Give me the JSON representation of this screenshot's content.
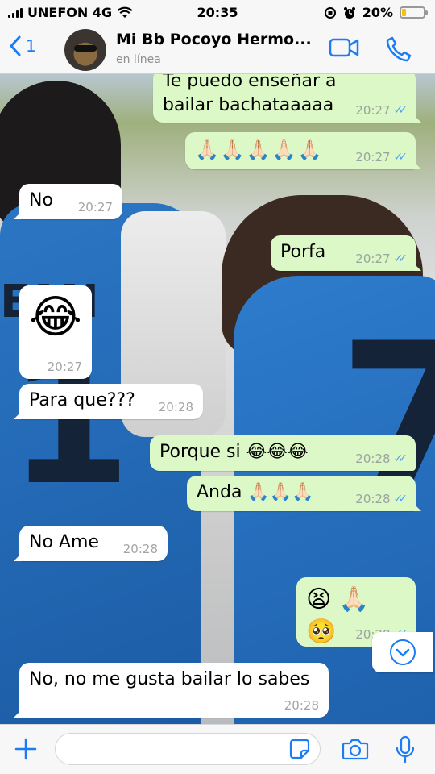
{
  "status": {
    "carrier": "UNEFON 4G",
    "time": "20:35",
    "battery": "20%",
    "battery_level": 0.2
  },
  "header": {
    "back_count": "1",
    "title": "Mi Bb Pocoyo Hermo...",
    "subtitle": "en línea"
  },
  "messages": [
    {
      "text": "Te puedo enseñar a bailar bachataaaaa",
      "time": "20:27",
      "dir": "out"
    },
    {
      "text": "🙏🏻🙏🏻🙏🏻🙏🏻🙏🏻",
      "time": "20:27",
      "dir": "out"
    },
    {
      "text": "No",
      "time": "20:27",
      "dir": "in"
    },
    {
      "text": "Porfa",
      "time": "20:27",
      "dir": "out"
    },
    {
      "text": "😂",
      "time": "20:27",
      "dir": "in"
    },
    {
      "text": "Para que???",
      "time": "20:28",
      "dir": "in"
    },
    {
      "text": "Porque si 😂😂😂",
      "time": "20:28",
      "dir": "out"
    },
    {
      "text": "Anda 🙏🏻🙏🏻🙏🏻",
      "time": "20:28",
      "dir": "out"
    },
    {
      "text": "No Ame",
      "time": "20:28",
      "dir": "in"
    },
    {
      "text": "😫 🙏🏻 🥺",
      "time": "20:28",
      "dir": "out"
    },
    {
      "text": "No, no me gusta bailar lo sabes",
      "time": "20:28",
      "dir": "in"
    }
  ],
  "colors": {
    "outgoing_bubble": "#dcf8c6",
    "incoming_bubble": "#ffffff",
    "accent": "#1b7cf5",
    "read_ticks": "#4fa3f5"
  },
  "icons": {
    "back": "chevron-left-icon",
    "video": "video-call-icon",
    "phone": "phone-icon",
    "plus": "plus-icon",
    "sticker": "sticker-icon",
    "camera": "camera-icon",
    "mic": "microphone-icon",
    "scroll": "chevron-down-icon"
  },
  "input": {
    "value": "",
    "placeholder": ""
  }
}
